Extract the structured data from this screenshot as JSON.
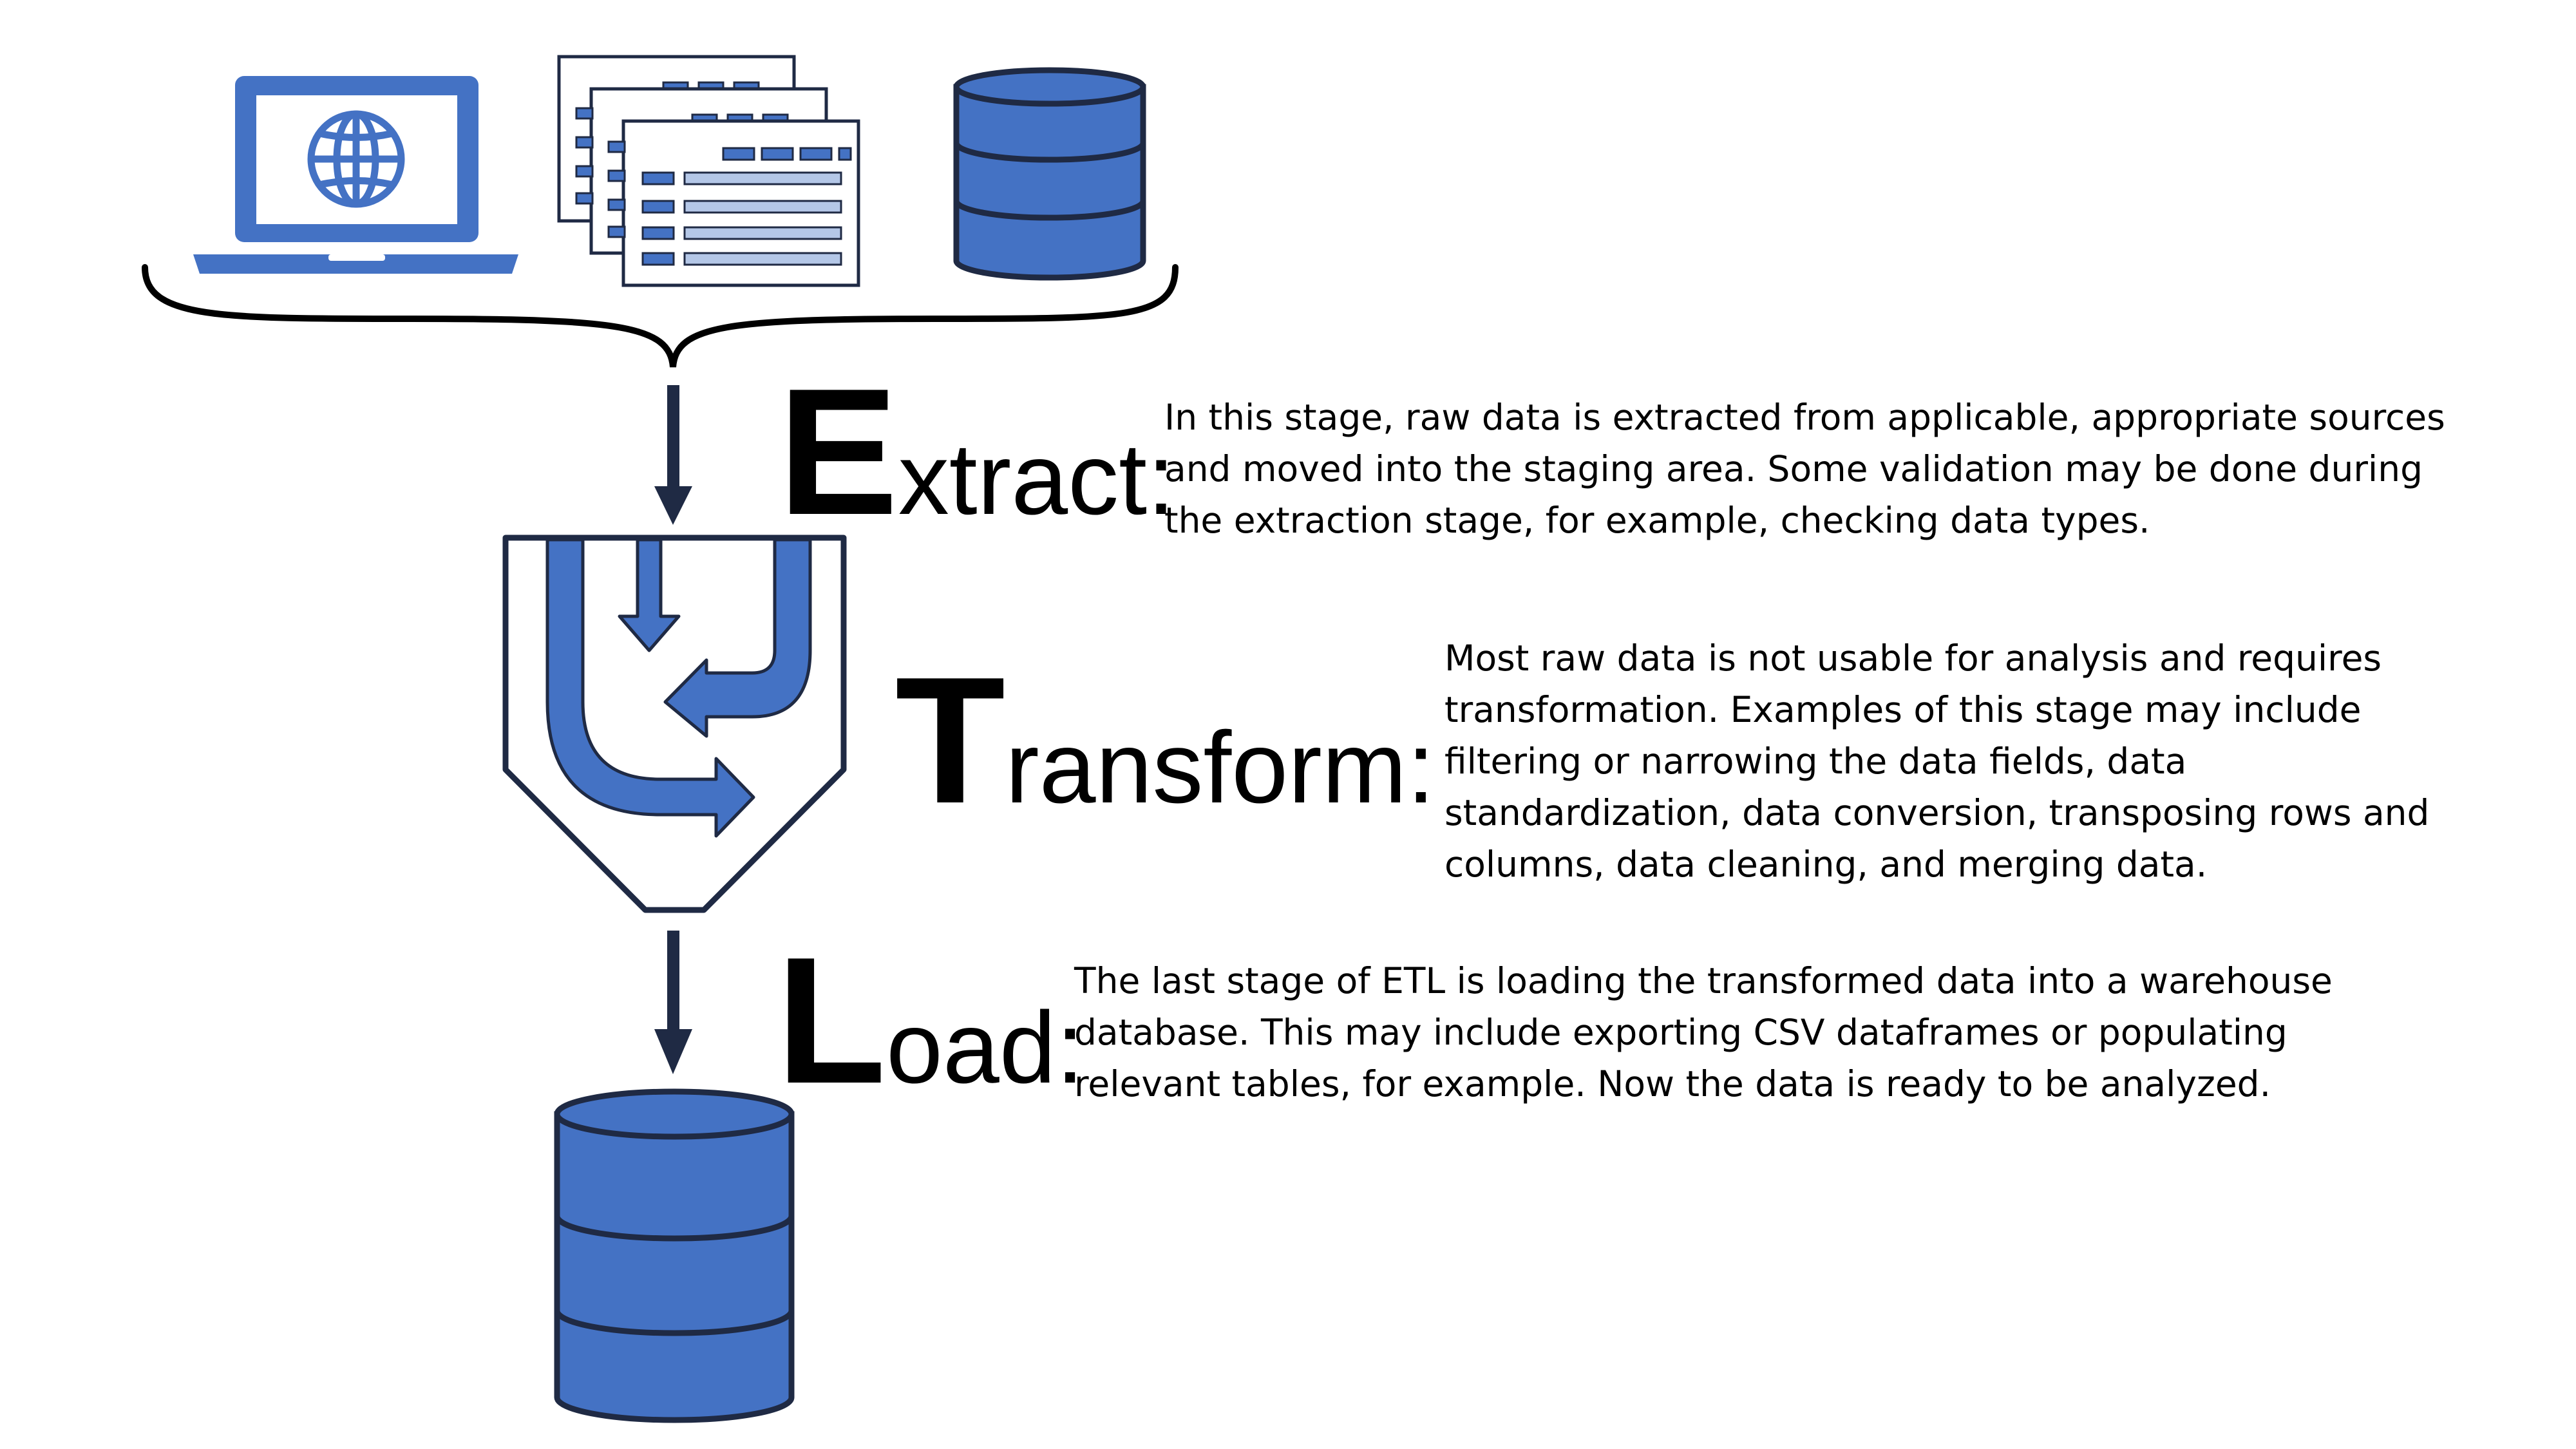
{
  "colors": {
    "accent": "#4472C4",
    "accent_light": "#B4C7E7",
    "outline": "#1F2A44",
    "text": "#000000"
  },
  "icons": [
    "laptop-globe-icon",
    "spreadsheet-documents-icon",
    "database-icon",
    "curly-brace",
    "down-arrow-icon",
    "funnel-transform-icon"
  ],
  "stages": [
    {
      "initial": "E",
      "rest": "xtract:",
      "description": "In this stage, raw data is extracted from applicable, appropriate sources and moved into the staging area. Some validation may be done during the extraction stage, for example, checking data types."
    },
    {
      "initial": "T",
      "rest": "ransform:",
      "description": "Most raw data is not usable for analysis and requires transformation. Examples of this stage may include filtering or narrowing the data fields, data standardization, data conversion, transposing rows and columns, data cleaning, and merging data."
    },
    {
      "initial": "L",
      "rest": "oad:",
      "description": "The last stage of ETL is loading the transformed data into a warehouse database. This may include exporting CSV dataframes or populating relevant tables, for example. Now the data is ready to be analyzed."
    }
  ]
}
